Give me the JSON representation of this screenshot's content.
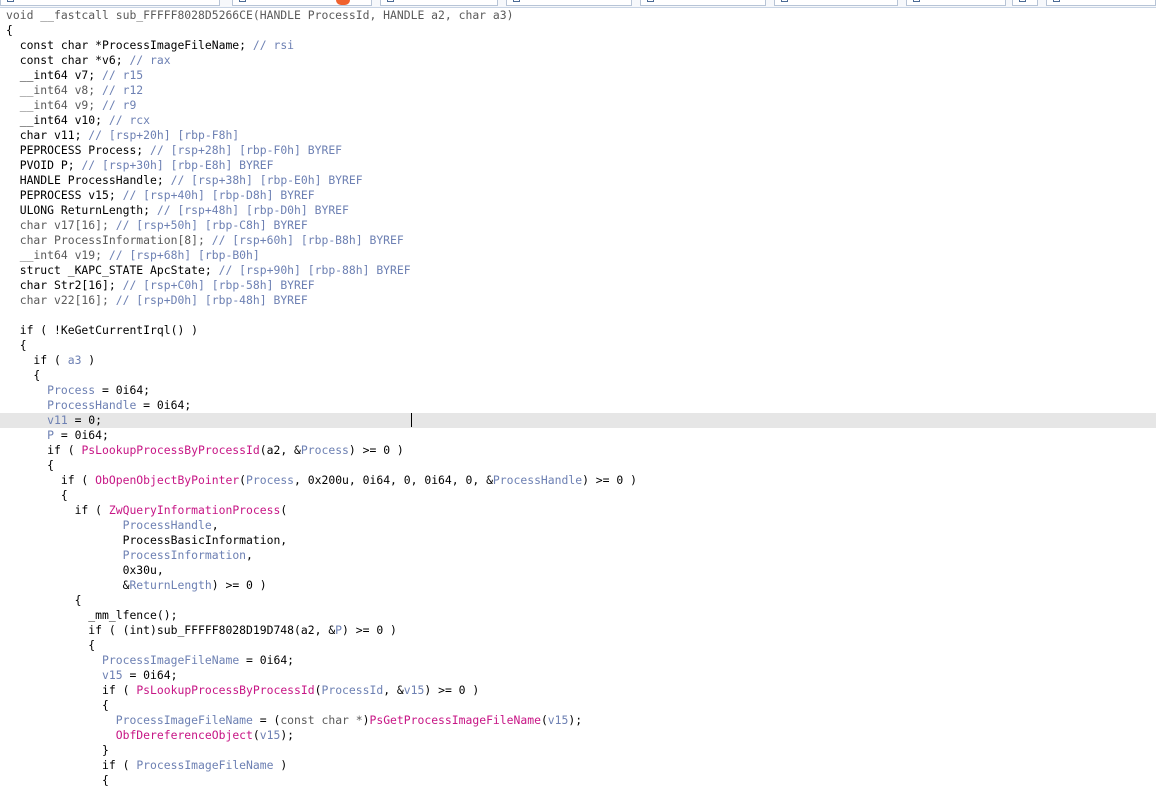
{
  "tabs": [
    {
      "label": "",
      "active": false
    },
    {
      "label": "",
      "active": true
    },
    {
      "label": "",
      "active": false
    },
    {
      "label": "",
      "active": false
    },
    {
      "label": "",
      "active": false
    },
    {
      "label": "",
      "active": false
    },
    {
      "label": "",
      "active": false
    },
    {
      "label": "",
      "active": false
    },
    {
      "label": "",
      "active": false
    }
  ],
  "colors": {
    "keyword": "#000000",
    "local_var": "#6d80b3",
    "function_call": "#c71585",
    "comment": "#6d80b3",
    "highlight_line": "#e6e6e6",
    "tab_accent": "#f0622e"
  },
  "code_lines": [
    [
      {
        "t": "void __fastcall sub_FFFFF8028D5266CE(HANDLE ProcessId, HANDLE a2, char a3)",
        "c": "gray"
      }
    ],
    [
      {
        "t": "{",
        "c": "id"
      }
    ],
    [
      {
        "t": "  const char *ProcessImageFileName; ",
        "c": "id"
      },
      {
        "t": "// rsi",
        "c": "cmt"
      }
    ],
    [
      {
        "t": "  const char *v6; ",
        "c": "id"
      },
      {
        "t": "// rax",
        "c": "cmt"
      }
    ],
    [
      {
        "t": "  __int64 v7; ",
        "c": "id"
      },
      {
        "t": "// r15",
        "c": "cmt"
      }
    ],
    [
      {
        "t": "  __int64 v8; ",
        "c": "gray"
      },
      {
        "t": "// r12",
        "c": "cmt"
      }
    ],
    [
      {
        "t": "  __int64 v9; ",
        "c": "gray"
      },
      {
        "t": "// r9",
        "c": "cmt"
      }
    ],
    [
      {
        "t": "  __int64 v10; ",
        "c": "id"
      },
      {
        "t": "// rcx",
        "c": "cmt"
      }
    ],
    [
      {
        "t": "  char v11; ",
        "c": "id"
      },
      {
        "t": "// [rsp+20h] [rbp-F8h]",
        "c": "cmt"
      }
    ],
    [
      {
        "t": "  PEPROCESS Process; ",
        "c": "id"
      },
      {
        "t": "// [rsp+28h] [rbp-F0h] BYREF",
        "c": "cmt"
      }
    ],
    [
      {
        "t": "  PVOID P; ",
        "c": "id"
      },
      {
        "t": "// [rsp+30h] [rbp-E8h] BYREF",
        "c": "cmt"
      }
    ],
    [
      {
        "t": "  HANDLE ProcessHandle; ",
        "c": "id"
      },
      {
        "t": "// [rsp+38h] [rbp-E0h] BYREF",
        "c": "cmt"
      }
    ],
    [
      {
        "t": "  PEPROCESS v15; ",
        "c": "id"
      },
      {
        "t": "// [rsp+40h] [rbp-D8h] BYREF",
        "c": "cmt"
      }
    ],
    [
      {
        "t": "  ULONG ReturnLength; ",
        "c": "id"
      },
      {
        "t": "// [rsp+48h] [rbp-D0h] BYREF",
        "c": "cmt"
      }
    ],
    [
      {
        "t": "  char v17[16]; ",
        "c": "gray"
      },
      {
        "t": "// [rsp+50h] [rbp-C8h] BYREF",
        "c": "cmt"
      }
    ],
    [
      {
        "t": "  char ProcessInformation[8]; ",
        "c": "gray"
      },
      {
        "t": "// [rsp+60h] [rbp-B8h] BYREF",
        "c": "cmt"
      }
    ],
    [
      {
        "t": "  __int64 v19; ",
        "c": "gray"
      },
      {
        "t": "// [rsp+68h] [rbp-B0h]",
        "c": "cmt"
      }
    ],
    [
      {
        "t": "  struct _KAPC_STATE ApcState; ",
        "c": "id"
      },
      {
        "t": "// [rsp+90h] [rbp-88h] BYREF",
        "c": "cmt"
      }
    ],
    [
      {
        "t": "  char Str2[16]; ",
        "c": "id"
      },
      {
        "t": "// [rsp+C0h] [rbp-58h] BYREF",
        "c": "cmt"
      }
    ],
    [
      {
        "t": "  char v22[16]; ",
        "c": "gray"
      },
      {
        "t": "// [rsp+D0h] [rbp-48h] BYREF",
        "c": "cmt"
      }
    ],
    [
      {
        "t": "",
        "c": "id"
      }
    ],
    [
      {
        "t": "  if ( !KeGetCurrentIrql() )",
        "c": "id"
      }
    ],
    [
      {
        "t": "  {",
        "c": "id"
      }
    ],
    [
      {
        "t": "    if ( ",
        "c": "id"
      },
      {
        "t": "a3",
        "c": "cmt"
      },
      {
        "t": " )",
        "c": "id"
      }
    ],
    [
      {
        "t": "    {",
        "c": "id"
      }
    ],
    [
      {
        "t": "      ",
        "c": "id"
      },
      {
        "t": "Process",
        "c": "cmt"
      },
      {
        "t": " = 0i64;",
        "c": "id"
      }
    ],
    [
      {
        "t": "      ",
        "c": "id"
      },
      {
        "t": "ProcessHandle",
        "c": "cmt"
      },
      {
        "t": " = 0i64;",
        "c": "id"
      }
    ],
    [
      {
        "t": "      ",
        "c": "id"
      },
      {
        "t": "v11",
        "c": "cmt"
      },
      {
        "t": " = 0;",
        "c": "id"
      }
    ],
    [
      {
        "t": "      ",
        "c": "id"
      },
      {
        "t": "P",
        "c": "cmt"
      },
      {
        "t": " = 0i64;",
        "c": "id"
      }
    ],
    [
      {
        "t": "      if ( ",
        "c": "id"
      },
      {
        "t": "PsLookupProcessByProcessId",
        "c": "fn"
      },
      {
        "t": "(a2, &",
        "c": "id"
      },
      {
        "t": "Process",
        "c": "cmt"
      },
      {
        "t": ") >= 0 )",
        "c": "id"
      }
    ],
    [
      {
        "t": "      {",
        "c": "id"
      }
    ],
    [
      {
        "t": "        if ( ",
        "c": "id"
      },
      {
        "t": "ObOpenObjectByPointer",
        "c": "fn"
      },
      {
        "t": "(",
        "c": "id"
      },
      {
        "t": "Process",
        "c": "cmt"
      },
      {
        "t": ", 0x200u, 0i64, 0, 0i64, 0, &",
        "c": "id"
      },
      {
        "t": "ProcessHandle",
        "c": "cmt"
      },
      {
        "t": ") >= 0 )",
        "c": "id"
      }
    ],
    [
      {
        "t": "        {",
        "c": "id"
      }
    ],
    [
      {
        "t": "          if ( ",
        "c": "id"
      },
      {
        "t": "ZwQueryInformationProcess",
        "c": "fn"
      },
      {
        "t": "(",
        "c": "id"
      }
    ],
    [
      {
        "t": "                 ",
        "c": "id"
      },
      {
        "t": "ProcessHandle",
        "c": "cmt"
      },
      {
        "t": ",",
        "c": "id"
      }
    ],
    [
      {
        "t": "                 ProcessBasicInformation,",
        "c": "id"
      }
    ],
    [
      {
        "t": "                 ",
        "c": "id"
      },
      {
        "t": "ProcessInformation",
        "c": "cmt"
      },
      {
        "t": ",",
        "c": "id"
      }
    ],
    [
      {
        "t": "                 0x30u,",
        "c": "id"
      }
    ],
    [
      {
        "t": "                 &",
        "c": "id"
      },
      {
        "t": "ReturnLength",
        "c": "cmt"
      },
      {
        "t": ") >= 0 )",
        "c": "id"
      }
    ],
    [
      {
        "t": "          {",
        "c": "id"
      }
    ],
    [
      {
        "t": "            _mm_lfence();",
        "c": "id"
      }
    ],
    [
      {
        "t": "            if ( (int)sub_FFFFF8028D19D748(a2, &",
        "c": "id"
      },
      {
        "t": "P",
        "c": "cmt"
      },
      {
        "t": ") >= 0 )",
        "c": "id"
      }
    ],
    [
      {
        "t": "            {",
        "c": "id"
      }
    ],
    [
      {
        "t": "              ",
        "c": "id"
      },
      {
        "t": "ProcessImageFileName",
        "c": "cmt"
      },
      {
        "t": " = 0i64;",
        "c": "id"
      }
    ],
    [
      {
        "t": "              ",
        "c": "id"
      },
      {
        "t": "v15",
        "c": "cmt"
      },
      {
        "t": " = 0i64;",
        "c": "id"
      }
    ],
    [
      {
        "t": "              if ( ",
        "c": "id"
      },
      {
        "t": "PsLookupProcessByProcessId",
        "c": "fn"
      },
      {
        "t": "(",
        "c": "id"
      },
      {
        "t": "ProcessId",
        "c": "cmt"
      },
      {
        "t": ", &",
        "c": "id"
      },
      {
        "t": "v15",
        "c": "cmt"
      },
      {
        "t": ") >= 0 )",
        "c": "id"
      }
    ],
    [
      {
        "t": "              {",
        "c": "id"
      }
    ],
    [
      {
        "t": "                ",
        "c": "id"
      },
      {
        "t": "ProcessImageFileName",
        "c": "cmt"
      },
      {
        "t": " = (",
        "c": "id"
      },
      {
        "t": "const char *",
        "c": "gray"
      },
      {
        "t": ")",
        "c": "id"
      },
      {
        "t": "PsGetProcessImageFileName",
        "c": "fn"
      },
      {
        "t": "(",
        "c": "id"
      },
      {
        "t": "v15",
        "c": "cmt"
      },
      {
        "t": ");",
        "c": "id"
      }
    ],
    [
      {
        "t": "                ",
        "c": "id"
      },
      {
        "t": "ObfDereferenceObject",
        "c": "fn"
      },
      {
        "t": "(",
        "c": "id"
      },
      {
        "t": "v15",
        "c": "cmt"
      },
      {
        "t": ");",
        "c": "id"
      }
    ],
    [
      {
        "t": "              }",
        "c": "id"
      }
    ],
    [
      {
        "t": "              if ( ",
        "c": "id"
      },
      {
        "t": "ProcessImageFileName",
        "c": "cmt"
      },
      {
        "t": " )",
        "c": "id"
      }
    ],
    [
      {
        "t": "              {",
        "c": "id"
      }
    ]
  ],
  "highlighted_line_index": 27
}
